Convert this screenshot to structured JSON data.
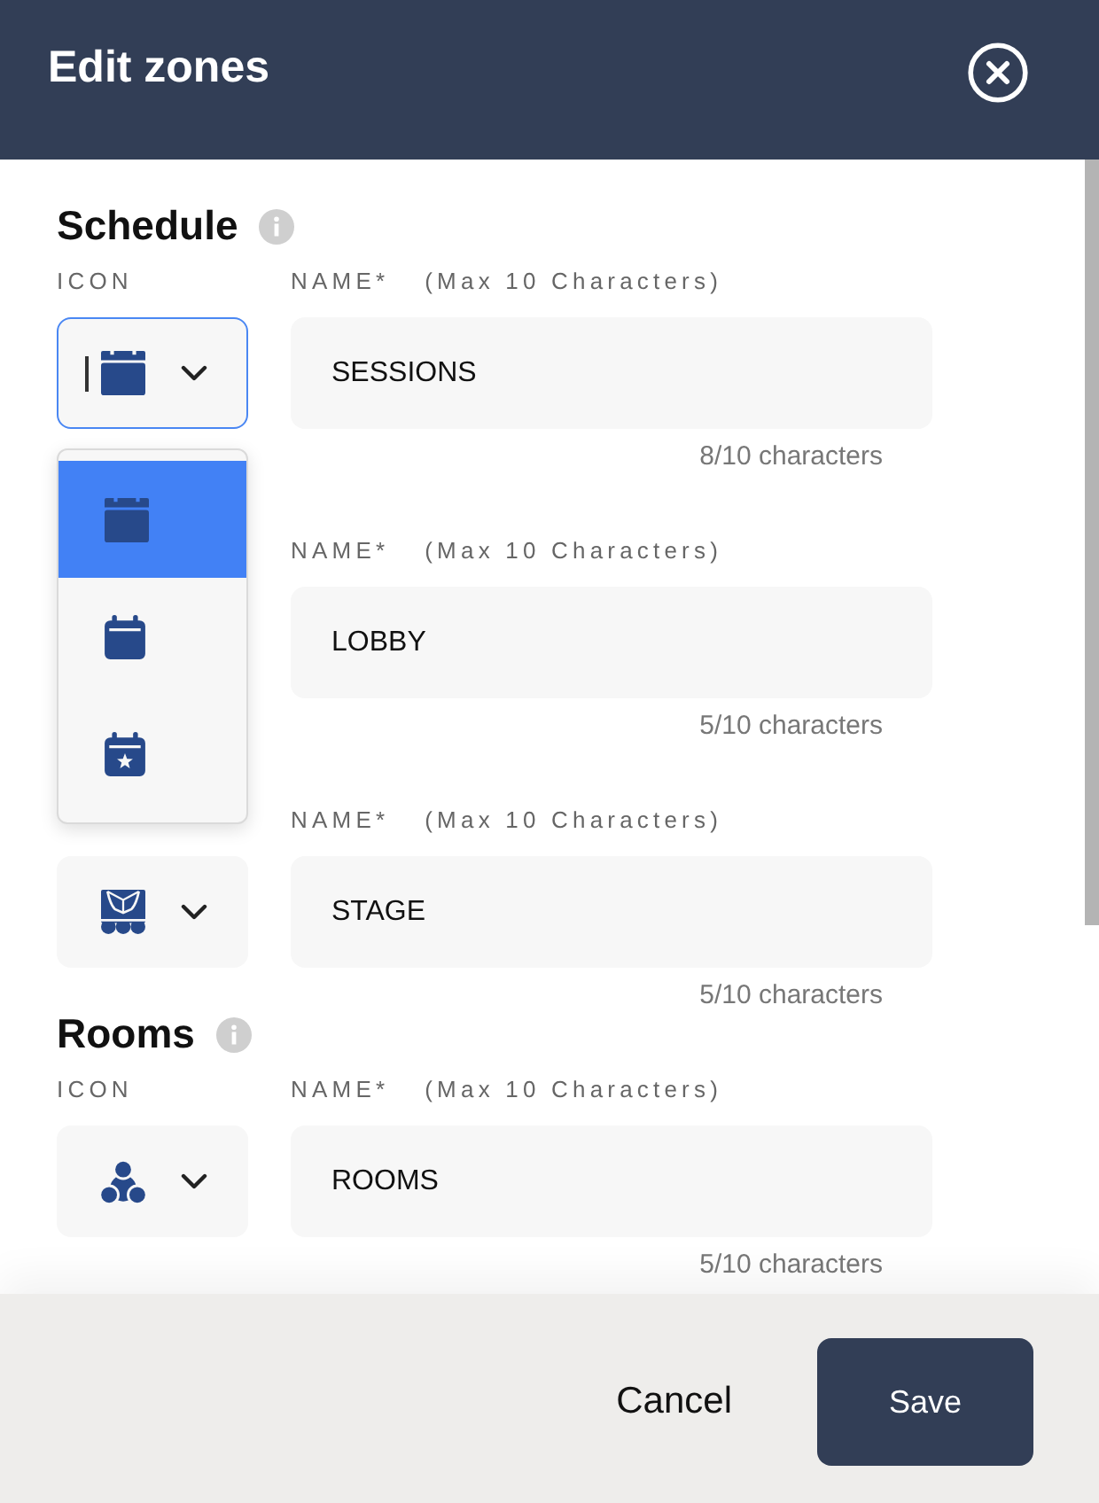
{
  "header": {
    "title": "Edit zones"
  },
  "zones": [
    {
      "title": "Schedule",
      "icon_label": "ICON",
      "kind": "calendar",
      "focused": true,
      "name_label": "NAME*",
      "name_hint": "(Max 10 Characters)",
      "value": "SESSIONS",
      "counter": "8/10 characters",
      "icon_menu": {
        "options": [
          {
            "kind": "calendar",
            "selected": true
          },
          {
            "kind": "planner",
            "selected": false
          },
          {
            "kind": "event",
            "selected": false
          }
        ]
      }
    },
    {
      "name_label": "NAME*",
      "name_hint": "(Max 10 Characters)",
      "value": "LOBBY",
      "counter": "5/10 characters"
    },
    {
      "kind": "stage",
      "focused": false,
      "name_label": "NAME*",
      "name_hint": "(Max 10 Characters)",
      "value": "STAGE",
      "counter": "5/10 characters"
    },
    {
      "title": "Rooms",
      "icon_label": "ICON",
      "kind": "rooms",
      "focused": false,
      "name_label": "NAME*",
      "name_hint": "(Max 10 Characters)",
      "value": "ROOMS",
      "counter": "5/10 characters"
    }
  ],
  "footer": {
    "cancel_button": "Cancel",
    "save_button": "Save"
  }
}
